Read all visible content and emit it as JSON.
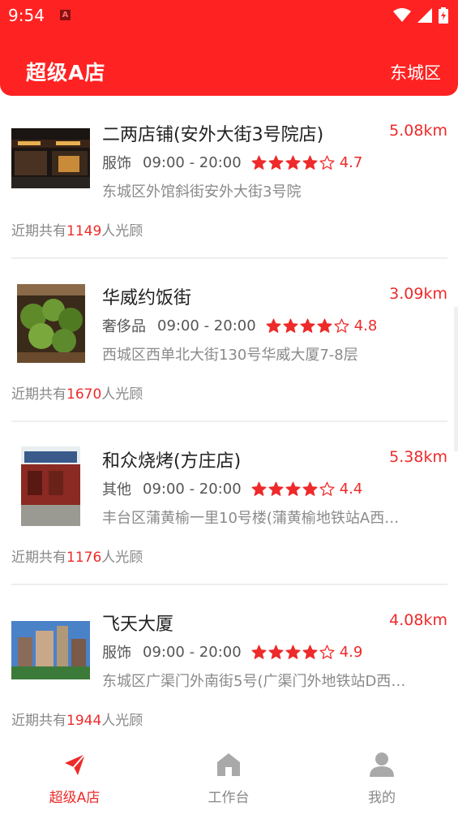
{
  "status_bar": {
    "time": "9:54",
    "notification_icon": "A"
  },
  "header": {
    "title": "超级A店",
    "district": "东城区"
  },
  "colors": {
    "brand_red": "#ff2222",
    "accent_red": "#ee2a2a"
  },
  "stores": [
    {
      "name": "二两店铺(安外大街3号院店)",
      "distance": "5.08km",
      "category": "服饰",
      "hours": "09:00 - 20:00",
      "rating": 4,
      "score": "4.7",
      "address": "东城区外馆斜街安外大街3号院",
      "visits_prefix": "近期共有",
      "visits": "1149",
      "visits_suffix": "人光顾"
    },
    {
      "name": "华威约饭街",
      "distance": "3.09km",
      "category": "奢侈品",
      "hours": "09:00 - 20:00",
      "rating": 4,
      "score": "4.8",
      "address": "西城区西单北大街130号华威大厦7-8层",
      "visits_prefix": "近期共有",
      "visits": "1670",
      "visits_suffix": "人光顾"
    },
    {
      "name": "和众烧烤(方庄店)",
      "distance": "5.38km",
      "category": "其他",
      "hours": "09:00 - 20:00",
      "rating": 4,
      "score": "4.4",
      "address": "丰台区蒲黄榆一里10号楼(蒲黄榆地铁站A西…",
      "visits_prefix": "近期共有",
      "visits": "1176",
      "visits_suffix": "人光顾"
    },
    {
      "name": "飞天大厦",
      "distance": "4.08km",
      "category": "服饰",
      "hours": "09:00 - 20:00",
      "rating": 4,
      "score": "4.9",
      "address": "东城区广渠门外南街5号(广渠门外地铁站D西…",
      "visits_prefix": "近期共有",
      "visits": "1944",
      "visits_suffix": "人光顾"
    }
  ],
  "tabs": [
    {
      "label": "超级A店",
      "icon": "paper-plane-icon",
      "active": true
    },
    {
      "label": "工作台",
      "icon": "home-icon",
      "active": false
    },
    {
      "label": "我的",
      "icon": "person-icon",
      "active": false
    }
  ]
}
